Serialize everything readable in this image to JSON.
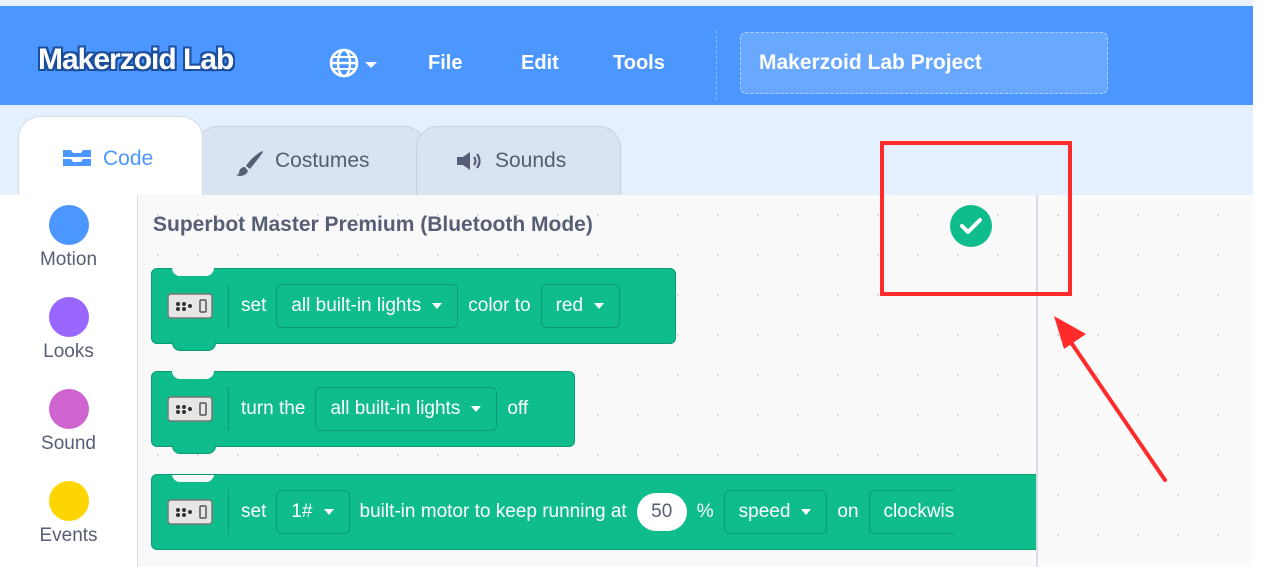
{
  "header": {
    "logo_text": "Makerzoid Lab",
    "menu": {
      "language_icon": "globe-icon",
      "file": "File",
      "edit": "Edit",
      "tools": "Tools"
    },
    "project_title": "Makerzoid Lab Project"
  },
  "tabs": [
    {
      "label": "Code",
      "icon": "code-icon",
      "active": true
    },
    {
      "label": "Costumes",
      "icon": "brush-icon",
      "active": false
    },
    {
      "label": "Sounds",
      "icon": "speaker-icon",
      "active": false
    }
  ],
  "categories": [
    {
      "label": "Motion",
      "color": "#4c97ff"
    },
    {
      "label": "Looks",
      "color": "#9966ff"
    },
    {
      "label": "Sound",
      "color": "#cf63cf"
    },
    {
      "label": "Events",
      "color": "#ffd500"
    }
  ],
  "palette": {
    "section_title": "Superbot Master Premium (Bluetooth Mode)",
    "status_icon": "check-circle-icon",
    "block_color": "#0fbd8c",
    "blocks": [
      {
        "text1": "set",
        "dropdown1": "all built-in lights",
        "text2": "color to",
        "dropdown2": "red"
      },
      {
        "text1": "turn the",
        "dropdown1": "all built-in lights",
        "text2": "off"
      },
      {
        "text1": "set",
        "dropdown1": "1#",
        "text2": "built-in motor to keep running at",
        "value": "50",
        "text3": "%",
        "dropdown2": "speed",
        "text4": "on",
        "dropdown3": "clockwis"
      }
    ]
  },
  "annotation": {
    "color": "#ff2b2b"
  }
}
